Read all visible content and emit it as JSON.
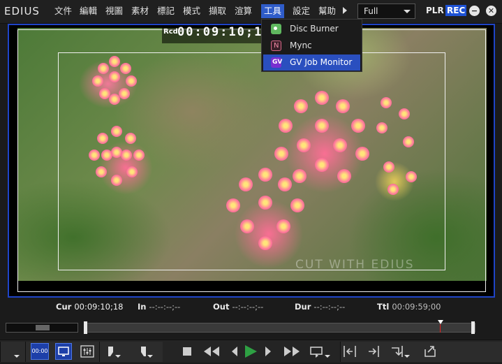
{
  "app": {
    "logo": "EDIUS"
  },
  "menu": {
    "items": [
      "文件",
      "編輯",
      "視圖",
      "素材",
      "標記",
      "模式",
      "擷取",
      "渲算",
      "工具",
      "設定",
      "幫助"
    ],
    "active_index": 8
  },
  "mode_select": {
    "value": "Full"
  },
  "badges": {
    "plr": "PLR",
    "rec": "REC"
  },
  "window_buttons": {
    "minimize": "−",
    "close": "✕"
  },
  "tools_menu": {
    "items": [
      {
        "label": "Disc Burner",
        "icon": "disc-burner-icon"
      },
      {
        "label": "Mync",
        "icon": "mync-icon"
      },
      {
        "label": "GV Job Monitor",
        "icon": "gv-job-monitor-icon"
      }
    ],
    "highlighted_index": 2
  },
  "preview": {
    "rcd_label": "Rcd",
    "rcd_timecode": "00:09:10;1",
    "watermark": "CUT WITH   EDIUS"
  },
  "info_row": {
    "cur_label": "Cur",
    "cur_value": "00:09:10;18",
    "in_label": "In",
    "in_value": "--:--:--;--",
    "out_label": "Out",
    "out_value": "--:--:--;--",
    "dur_label": "Dur",
    "dur_value": "--:--:--;--",
    "ttl_label": "Ttl",
    "ttl_value": "00:09:59;00"
  },
  "toolbar": {
    "timecode_button": "00:00"
  },
  "colors": {
    "accent_blue": "#1f44c8",
    "menu_highlight": "#2f5cc9",
    "play_green": "#2ea043",
    "playhead_red": "#dd2222"
  }
}
